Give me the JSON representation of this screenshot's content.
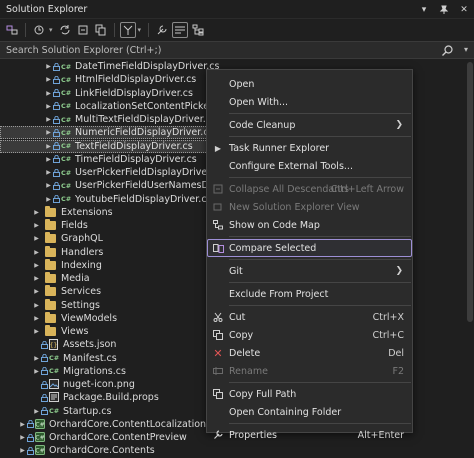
{
  "window": {
    "title": "Solution Explorer"
  },
  "search": {
    "placeholder": "Search Solution Explorer (Ctrl+;)"
  },
  "tree": {
    "rows": [
      {
        "label": "DateTimeFieldDisplayDriver.cs",
        "kind": "cs",
        "depth": 3
      },
      {
        "label": "HtmlFieldDisplayDriver.cs",
        "kind": "cs",
        "depth": 3
      },
      {
        "label": "LinkFieldDisplayDriver.cs",
        "kind": "cs",
        "depth": 3
      },
      {
        "label": "LocalizationSetContentPickerFie",
        "kind": "cs",
        "depth": 3
      },
      {
        "label": "MultiTextFieldDisplayDriver.cs",
        "kind": "cs",
        "depth": 3
      },
      {
        "label": "NumericFieldDisplayDriver.cs",
        "kind": "cs",
        "depth": 3,
        "selected": true
      },
      {
        "label": "TextFieldDisplayDriver.cs",
        "kind": "cs",
        "depth": 3,
        "selected": true
      },
      {
        "label": "TimeFieldDisplayDriver.cs",
        "kind": "cs",
        "depth": 3
      },
      {
        "label": "UserPickerFieldDisplayDriver.cs",
        "kind": "cs",
        "depth": 3
      },
      {
        "label": "UserPickerFieldUserNamesDispla",
        "kind": "cs",
        "depth": 3
      },
      {
        "label": "YoutubeFieldDisplayDriver.cs",
        "kind": "cs",
        "depth": 3
      },
      {
        "label": "Extensions",
        "kind": "folder",
        "depth": 2
      },
      {
        "label": "Fields",
        "kind": "folder",
        "depth": 2
      },
      {
        "label": "GraphQL",
        "kind": "folder",
        "depth": 2
      },
      {
        "label": "Handlers",
        "kind": "folder",
        "depth": 2
      },
      {
        "label": "Indexing",
        "kind": "folder",
        "depth": 2
      },
      {
        "label": "Media",
        "kind": "folder",
        "depth": 2
      },
      {
        "label": "Services",
        "kind": "folder",
        "depth": 2
      },
      {
        "label": "Settings",
        "kind": "folder",
        "depth": 2
      },
      {
        "label": "ViewModels",
        "kind": "folder",
        "depth": 2
      },
      {
        "label": "Views",
        "kind": "folder",
        "depth": 2
      },
      {
        "label": "Assets.json",
        "kind": "json",
        "depth": 2
      },
      {
        "label": "Manifest.cs",
        "kind": "cs",
        "depth": 2
      },
      {
        "label": "Migrations.cs",
        "kind": "cs",
        "depth": 2
      },
      {
        "label": "nuget-icon.png",
        "kind": "png",
        "depth": 2
      },
      {
        "label": "Package.Build.props",
        "kind": "props",
        "depth": 2
      },
      {
        "label": "Startup.cs",
        "kind": "cs",
        "depth": 2
      },
      {
        "label": "OrchardCore.ContentLocalization",
        "kind": "project",
        "depth": 1
      },
      {
        "label": "OrchardCore.ContentPreview",
        "kind": "project",
        "depth": 1
      },
      {
        "label": "OrchardCore.Contents",
        "kind": "project",
        "depth": 1
      }
    ]
  },
  "context_menu": {
    "items": [
      {
        "label": "Open",
        "icon": "open-icon",
        "shortcut": "",
        "submenu": false,
        "disabled": false
      },
      {
        "label": "Open With...",
        "icon": "",
        "shortcut": "",
        "submenu": false,
        "disabled": false
      },
      {
        "sep": true
      },
      {
        "label": "Code Cleanup",
        "icon": "",
        "shortcut": "",
        "submenu": true,
        "disabled": false
      },
      {
        "sep": true
      },
      {
        "label": "Task Runner Explorer",
        "icon": "task-runner-icon",
        "shortcut": "",
        "submenu": false,
        "disabled": false
      },
      {
        "label": "Configure External Tools...",
        "icon": "",
        "shortcut": "",
        "submenu": false,
        "disabled": false
      },
      {
        "sep": true
      },
      {
        "label": "Collapse All Descendants",
        "icon": "collapse-icon",
        "shortcut": "Ctrl+Left Arrow",
        "submenu": false,
        "disabled": true
      },
      {
        "label": "New Solution Explorer View",
        "icon": "new-view-icon",
        "shortcut": "",
        "submenu": false,
        "disabled": true
      },
      {
        "label": "Show on Code Map",
        "icon": "code-map-icon",
        "shortcut": "",
        "submenu": false,
        "disabled": false
      },
      {
        "sep": true
      },
      {
        "label": "Compare Selected",
        "icon": "compare-icon",
        "shortcut": "",
        "submenu": false,
        "disabled": false,
        "highlighted": true
      },
      {
        "sep": true
      },
      {
        "label": "Git",
        "icon": "",
        "shortcut": "",
        "submenu": true,
        "disabled": false
      },
      {
        "sep": true
      },
      {
        "label": "Exclude From Project",
        "icon": "",
        "shortcut": "",
        "submenu": false,
        "disabled": false
      },
      {
        "sep": true
      },
      {
        "label": "Cut",
        "icon": "cut-icon",
        "shortcut": "Ctrl+X",
        "submenu": false,
        "disabled": false
      },
      {
        "label": "Copy",
        "icon": "copy-icon",
        "shortcut": "Ctrl+C",
        "submenu": false,
        "disabled": false
      },
      {
        "label": "Delete",
        "icon": "delete-icon",
        "shortcut": "Del",
        "submenu": false,
        "disabled": false
      },
      {
        "label": "Rename",
        "icon": "rename-icon",
        "shortcut": "F2",
        "submenu": false,
        "disabled": true
      },
      {
        "sep": true
      },
      {
        "label": "Copy Full Path",
        "icon": "copy-path-icon",
        "shortcut": "",
        "submenu": false,
        "disabled": false
      },
      {
        "label": "Open Containing Folder",
        "icon": "",
        "shortcut": "",
        "submenu": false,
        "disabled": false
      },
      {
        "sep": true
      },
      {
        "label": "Properties",
        "icon": "wrench-icon",
        "shortcut": "Alt+Enter",
        "submenu": false,
        "disabled": false
      }
    ]
  },
  "colors": {
    "background": "#1f1f1f",
    "menu_background": "#2b2b2b",
    "highlight_border": "#9d8fd6",
    "folder": "#d9b45a",
    "csharp": "#7fb87f",
    "delete": "#e05555"
  }
}
